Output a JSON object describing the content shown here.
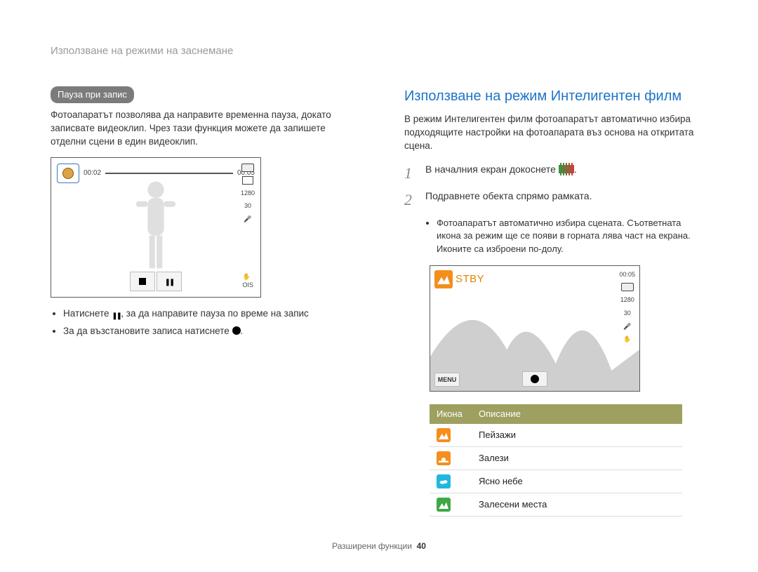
{
  "breadcrumb": "Използване на режими на заснемане",
  "left": {
    "pill": "Пауза при запис",
    "intro": "Фотоапаратът позволява да направите временна пауза, докато записвате видеоклип. Чрез тази функция можете да запишете отделни сцени в един видеоклип.",
    "time_left": "00:02",
    "time_right": "00:05",
    "res_badge": "1280",
    "fps_badge": "30",
    "pause_bullet_pre": "Натиснете ",
    "pause_bullet_post": ", за да направите пауза по време на запис",
    "resume_bullet_pre": "За да възстановите записа натиснете ",
    "resume_bullet_post": "."
  },
  "right": {
    "title": "Използване на режим Интелигентен филм",
    "intro": "В режим Интелигентен филм фотоапаратът автоматично избира подходящите настройки на фотоапарата въз основа на откритата сцена.",
    "step1_pre": "В началния екран докоснете ",
    "step1_post": ".",
    "step2": "Подравнете обекта спрямо рамката.",
    "sub_bullet": "Фотоапаратът автоматично избира сцената. Съответната икона за режим ще се появи в горната лява част на екрана. Иконите са изброени по-долу.",
    "preview": {
      "stby": "STBY",
      "time": "00:05",
      "res": "1280",
      "menu": "MENU"
    },
    "table": {
      "col_icon": "Икона",
      "col_desc": "Описание",
      "rows": [
        {
          "icon": "landscape",
          "label": "Пейзажи"
        },
        {
          "icon": "sunset",
          "label": "Залези"
        },
        {
          "icon": "sky",
          "label": "Ясно небе"
        },
        {
          "icon": "forest",
          "label": "Залесени места"
        }
      ]
    }
  },
  "footer": {
    "section": "Разширени функции",
    "page": "40"
  }
}
